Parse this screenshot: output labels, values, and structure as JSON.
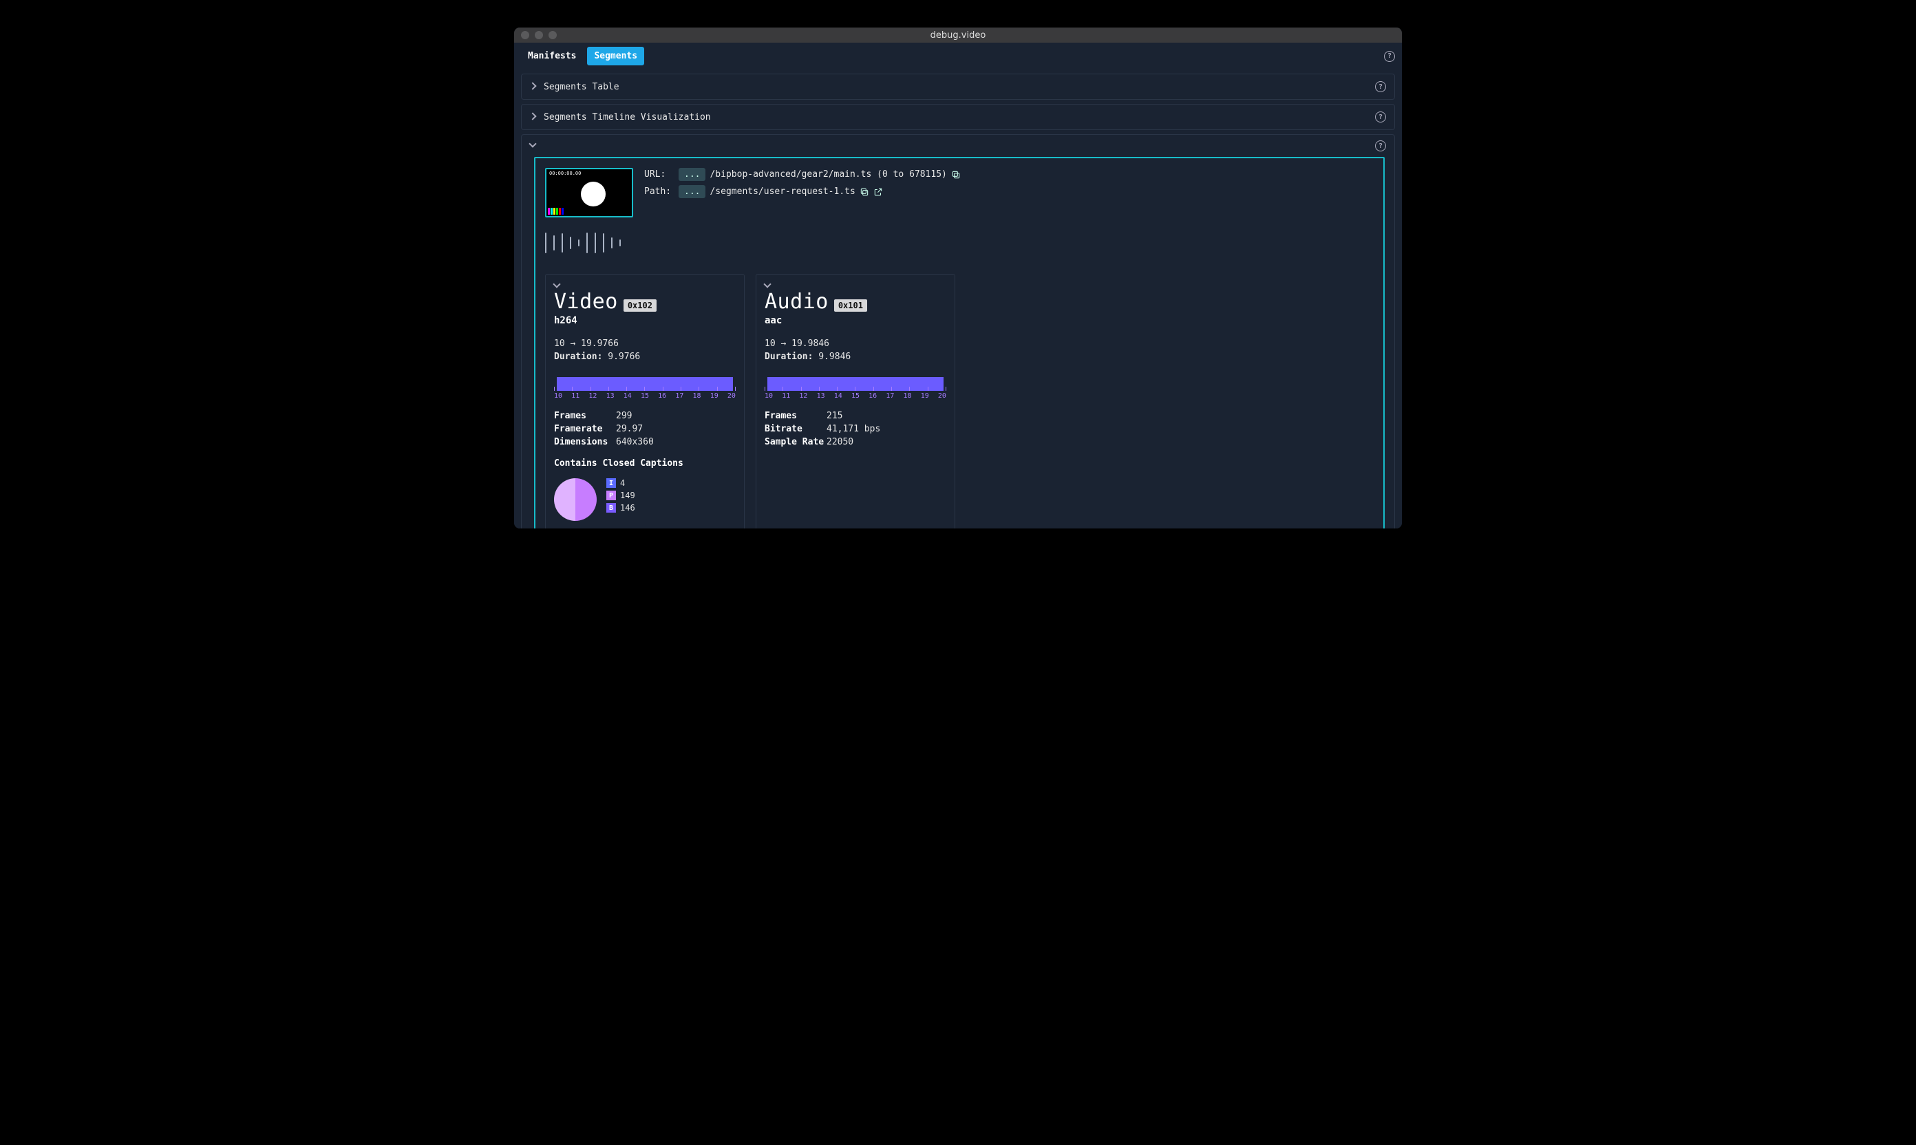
{
  "window": {
    "title": "debug.video"
  },
  "tabs": {
    "manifests": "Manifests",
    "segments": "Segments",
    "active": "segments"
  },
  "sections": {
    "table": "Segments Table",
    "timeline": "Segments Timeline Visualization"
  },
  "segment": {
    "url_label": "URL:",
    "url_prefix": "...",
    "url_rest": "/bipbop-advanced/gear2/main.ts (0 to 678115)",
    "path_label": "Path:",
    "path_prefix": "...",
    "path_rest": "/segments/user-request-1.ts",
    "thumb_tc": "00:00:00.00"
  },
  "timeline_ticks": [
    "10",
    "11",
    "12",
    "13",
    "14",
    "15",
    "16",
    "17",
    "18",
    "19",
    "20"
  ],
  "video": {
    "title": "Video",
    "pid": "0x102",
    "codec": "h264",
    "range": "10 → 19.9766",
    "duration_label": "Duration:",
    "duration": "9.9766",
    "stats": {
      "frames_k": "Frames",
      "frames_v": "299",
      "framerate_k": "Framerate",
      "framerate_v": "29.97",
      "dims_k": "Dimensions",
      "dims_v": "640x360"
    },
    "cc": "Contains Closed Captions",
    "frame_types": {
      "I": {
        "label": "I",
        "count": "4",
        "color": "#5b6bff"
      },
      "P": {
        "label": "P",
        "count": "149",
        "color": "#c77dff"
      },
      "B": {
        "label": "B",
        "count": "146",
        "color": "#7a5cff"
      }
    }
  },
  "audio": {
    "title": "Audio",
    "pid": "0x101",
    "codec": "aac",
    "range": "10 → 19.9846",
    "duration_label": "Duration:",
    "duration": "9.9846",
    "stats": {
      "frames_k": "Frames",
      "frames_v": "215",
      "bitrate_k": "Bitrate",
      "bitrate_v": "41,171 bps",
      "sr_k": "Sample Rate",
      "sr_v": "22050"
    }
  },
  "chart_data": [
    {
      "type": "bar",
      "title": "Video track timeline",
      "x_range": [
        10,
        20
      ],
      "series": [
        {
          "name": "video",
          "start": 10,
          "end": 19.9766
        }
      ],
      "ticks": [
        10,
        11,
        12,
        13,
        14,
        15,
        16,
        17,
        18,
        19,
        20
      ]
    },
    {
      "type": "bar",
      "title": "Audio track timeline",
      "x_range": [
        10,
        20
      ],
      "series": [
        {
          "name": "audio",
          "start": 10,
          "end": 19.9846
        }
      ],
      "ticks": [
        10,
        11,
        12,
        13,
        14,
        15,
        16,
        17,
        18,
        19,
        20
      ]
    },
    {
      "type": "pie",
      "title": "Video frame type distribution",
      "categories": [
        "I",
        "P",
        "B"
      ],
      "values": [
        4,
        149,
        146
      ]
    }
  ]
}
